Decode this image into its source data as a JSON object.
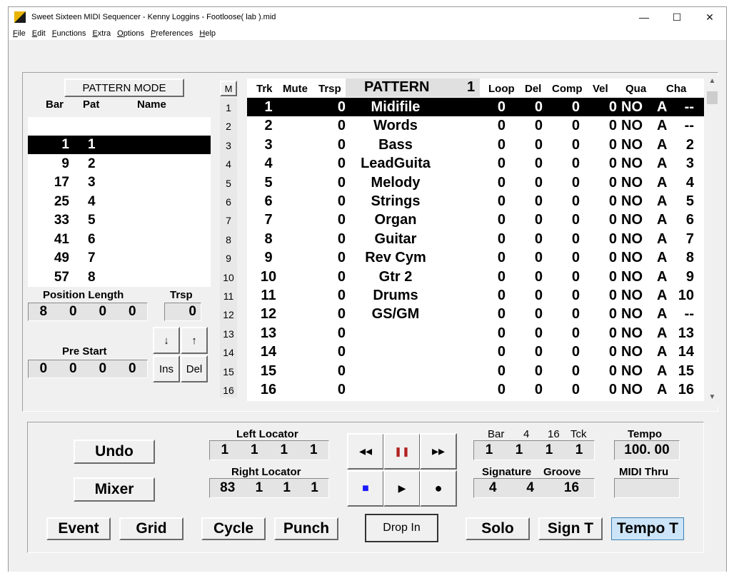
{
  "window": {
    "title": "Sweet Sixteen MIDI Sequencer - Kenny Loggins - Footloose( lab ).mid",
    "minimize": "—",
    "maximize": "☐",
    "close": "✕"
  },
  "menu": [
    {
      "u": "F",
      "rest": "ile"
    },
    {
      "u": "E",
      "rest": "dit"
    },
    {
      "u": "F",
      "rest": "unctions"
    },
    {
      "u": "E",
      "rest": "xtra"
    },
    {
      "u": "O",
      "rest": "ptions"
    },
    {
      "u": "P",
      "rest": "references"
    },
    {
      "u": "H",
      "rest": "elp"
    }
  ],
  "pattern_panel": {
    "mode_button": "PATTERN MODE",
    "headers": {
      "bar": "Bar",
      "pat": "Pat",
      "name": "Name"
    },
    "rows": [
      {
        "bar": "1",
        "pat": "1"
      },
      {
        "bar": "9",
        "pat": "2"
      },
      {
        "bar": "17",
        "pat": "3"
      },
      {
        "bar": "25",
        "pat": "4"
      },
      {
        "bar": "33",
        "pat": "5"
      },
      {
        "bar": "41",
        "pat": "6"
      },
      {
        "bar": "49",
        "pat": "7"
      },
      {
        "bar": "57",
        "pat": "8"
      }
    ],
    "selected_row": 0,
    "position_length_label": "Position Length",
    "position_length": [
      "8",
      "0",
      "0",
      "0"
    ],
    "trsp_label": "Trsp",
    "trsp_value": "0",
    "pre_start_label": "Pre Start",
    "pre_start": [
      "0",
      "0",
      "0",
      "0"
    ],
    "down_arrow": "↓",
    "up_arrow": "↑",
    "ins": "Ins",
    "del": "Del"
  },
  "m_button": "M",
  "row_numbers": [
    "1",
    "2",
    "3",
    "4",
    "5",
    "6",
    "7",
    "8",
    "9",
    "10",
    "11",
    "12",
    "13",
    "14",
    "15",
    "16"
  ],
  "track_table": {
    "headers": {
      "trk": "Trk",
      "mute": "Mute",
      "trsp": "Trsp",
      "pattern": "PATTERN",
      "pattern_num": "1",
      "loop": "Loop",
      "del": "Del",
      "comp": "Comp",
      "vel": "Vel",
      "qua": "Qua",
      "cha": "Cha"
    },
    "selected_row": 0,
    "rows": [
      {
        "trk": "1",
        "trsp": "0",
        "name": "Midifile",
        "loop": "0",
        "del": "0",
        "comp": "0",
        "vel": "0",
        "qua": "NO",
        "a": "A",
        "cha": "--"
      },
      {
        "trk": "2",
        "trsp": "0",
        "name": "Words",
        "loop": "0",
        "del": "0",
        "comp": "0",
        "vel": "0",
        "qua": "NO",
        "a": "A",
        "cha": "--"
      },
      {
        "trk": "3",
        "trsp": "0",
        "name": "Bass",
        "loop": "0",
        "del": "0",
        "comp": "0",
        "vel": "0",
        "qua": "NO",
        "a": "A",
        "cha": "2"
      },
      {
        "trk": "4",
        "trsp": "0",
        "name": "LeadGuita",
        "loop": "0",
        "del": "0",
        "comp": "0",
        "vel": "0",
        "qua": "NO",
        "a": "A",
        "cha": "3"
      },
      {
        "trk": "5",
        "trsp": "0",
        "name": "Melody",
        "loop": "0",
        "del": "0",
        "comp": "0",
        "vel": "0",
        "qua": "NO",
        "a": "A",
        "cha": "4"
      },
      {
        "trk": "6",
        "trsp": "0",
        "name": "Strings",
        "loop": "0",
        "del": "0",
        "comp": "0",
        "vel": "0",
        "qua": "NO",
        "a": "A",
        "cha": "5"
      },
      {
        "trk": "7",
        "trsp": "0",
        "name": "Organ",
        "loop": "0",
        "del": "0",
        "comp": "0",
        "vel": "0",
        "qua": "NO",
        "a": "A",
        "cha": "6"
      },
      {
        "trk": "8",
        "trsp": "0",
        "name": "Guitar",
        "loop": "0",
        "del": "0",
        "comp": "0",
        "vel": "0",
        "qua": "NO",
        "a": "A",
        "cha": "7"
      },
      {
        "trk": "9",
        "trsp": "0",
        "name": "Rev Cym",
        "loop": "0",
        "del": "0",
        "comp": "0",
        "vel": "0",
        "qua": "NO",
        "a": "A",
        "cha": "8"
      },
      {
        "trk": "10",
        "trsp": "0",
        "name": "Gtr 2",
        "loop": "0",
        "del": "0",
        "comp": "0",
        "vel": "0",
        "qua": "NO",
        "a": "A",
        "cha": "9"
      },
      {
        "trk": "11",
        "trsp": "0",
        "name": "Drums",
        "loop": "0",
        "del": "0",
        "comp": "0",
        "vel": "0",
        "qua": "NO",
        "a": "A",
        "cha": "10"
      },
      {
        "trk": "12",
        "trsp": "0",
        "name": "GS/GM",
        "loop": "0",
        "del": "0",
        "comp": "0",
        "vel": "0",
        "qua": "NO",
        "a": "A",
        "cha": "--"
      },
      {
        "trk": "13",
        "trsp": "0",
        "name": "",
        "loop": "0",
        "del": "0",
        "comp": "0",
        "vel": "0",
        "qua": "NO",
        "a": "A",
        "cha": "13"
      },
      {
        "trk": "14",
        "trsp": "0",
        "name": "",
        "loop": "0",
        "del": "0",
        "comp": "0",
        "vel": "0",
        "qua": "NO",
        "a": "A",
        "cha": "14"
      },
      {
        "trk": "15",
        "trsp": "0",
        "name": "",
        "loop": "0",
        "del": "0",
        "comp": "0",
        "vel": "0",
        "qua": "NO",
        "a": "A",
        "cha": "15"
      },
      {
        "trk": "16",
        "trsp": "0",
        "name": "",
        "loop": "0",
        "del": "0",
        "comp": "0",
        "vel": "0",
        "qua": "NO",
        "a": "A",
        "cha": "16"
      }
    ]
  },
  "scroll": {
    "up": "▲",
    "down": "▼"
  },
  "bottom": {
    "undo": "Undo",
    "mixer": "Mixer",
    "event": "Event",
    "grid": "Grid",
    "cycle": "Cycle",
    "punch": "Punch",
    "drop_in": "Drop In",
    "solo": "Solo",
    "sign_t": "Sign T",
    "tempo_t": "Tempo T",
    "left_locator_label": "Left Locator",
    "left_locator": [
      "1",
      "1",
      "1",
      "1"
    ],
    "right_locator_label": "Right Locator",
    "right_locator": [
      "83",
      "1",
      "1",
      "1"
    ],
    "position_headers": {
      "bar": "Bar",
      "beat": "4",
      "sixteenth": "16",
      "tck": "Tck"
    },
    "position": [
      "1",
      "1",
      "1",
      "1"
    ],
    "signature_label": "Signature",
    "groove_label": "Groove",
    "signature": [
      "4",
      "4"
    ],
    "groove": "16",
    "tempo_label": "Tempo",
    "tempo": "100. 00",
    "midi_thru_label": "MIDI Thru",
    "midi_thru_value": "",
    "transport": {
      "rewind": "◂◂",
      "pause": "❚❚",
      "forward": "▸▸",
      "stop": "■",
      "play": "▶",
      "record": "●"
    }
  },
  "colors": {
    "selected_bg": "#000000",
    "active_button": "#cce4f7",
    "stop_blue": "#1a1aff",
    "pause_red": "#b22222"
  }
}
